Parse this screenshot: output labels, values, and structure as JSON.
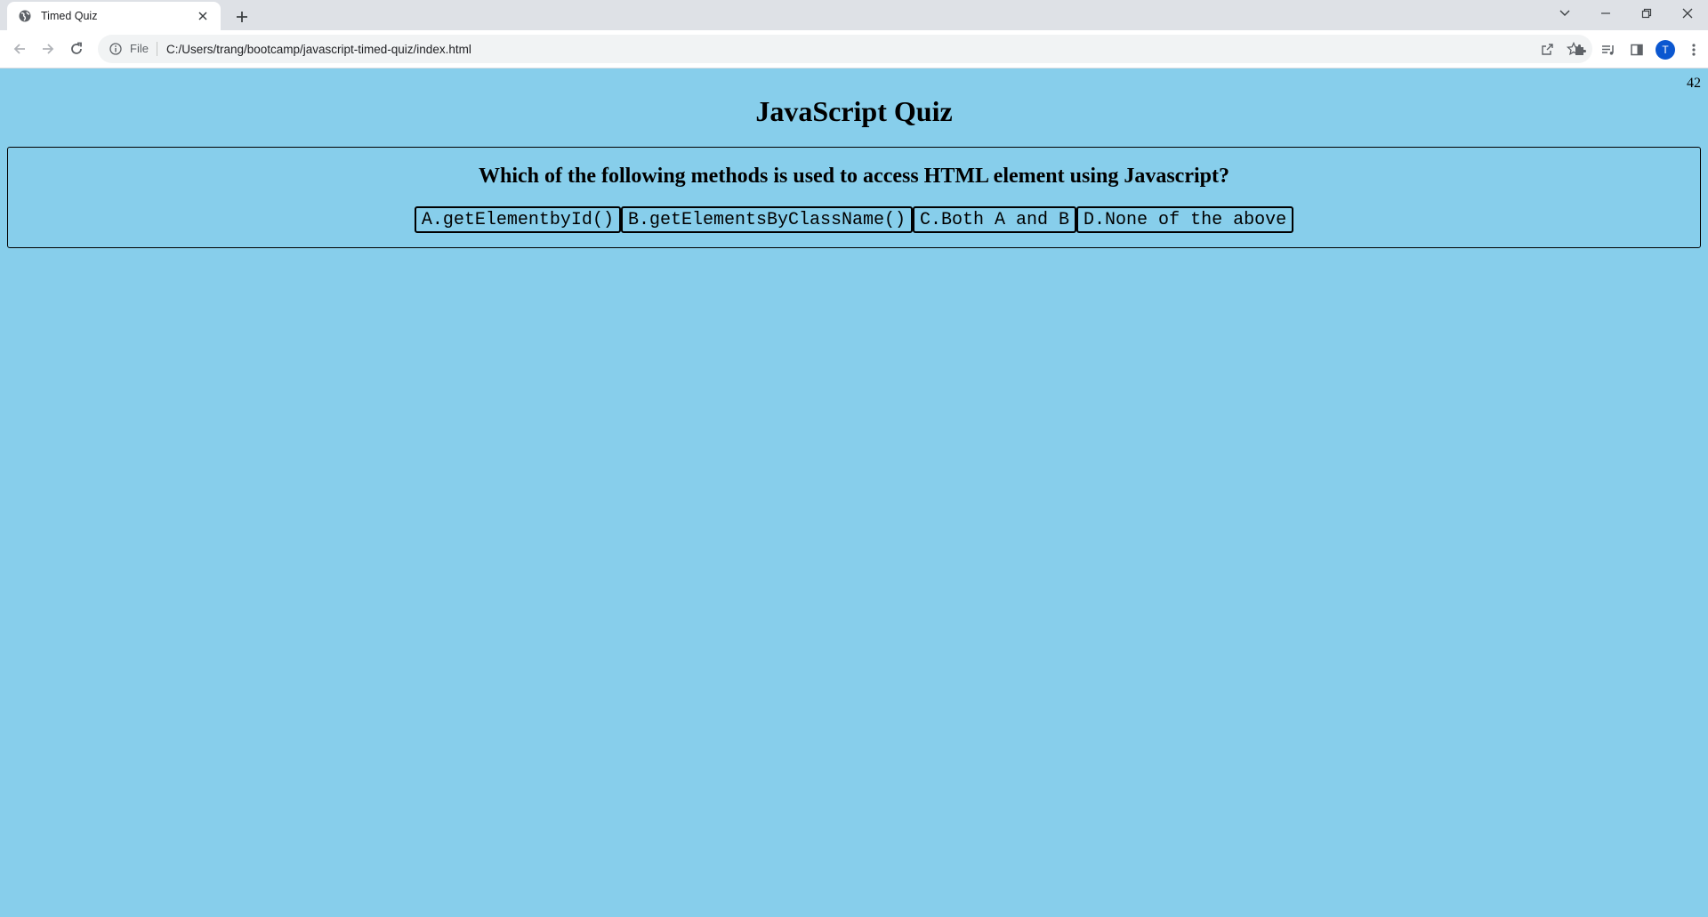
{
  "browser": {
    "tab": {
      "title": "Timed Quiz"
    },
    "address": {
      "scheme_label": "File",
      "url": "C:/Users/trang/bootcamp/javascript-timed-quiz/index.html"
    },
    "profile_initial": "T",
    "icons": {
      "favicon": "globe-icon",
      "close": "close-icon",
      "new_tab": "plus-icon",
      "back": "back-arrow-icon",
      "forward": "forward-arrow-icon",
      "reload": "reload-icon",
      "info": "info-icon",
      "share": "share-icon",
      "bookmark": "star-icon",
      "extensions": "puzzle-icon",
      "media": "media-control-icon",
      "side_panel": "side-panel-icon",
      "menu": "kebab-menu-icon"
    }
  },
  "page": {
    "timer": "42",
    "title": "JavaScript Quiz",
    "question": "Which of the following methods is used to access HTML element using Javascript?",
    "answers": [
      "A.getElementbyId()",
      "B.getElementsByClassName()",
      "C.Both A and B",
      "D.None of the above"
    ],
    "background_color": "#87ceeb"
  }
}
